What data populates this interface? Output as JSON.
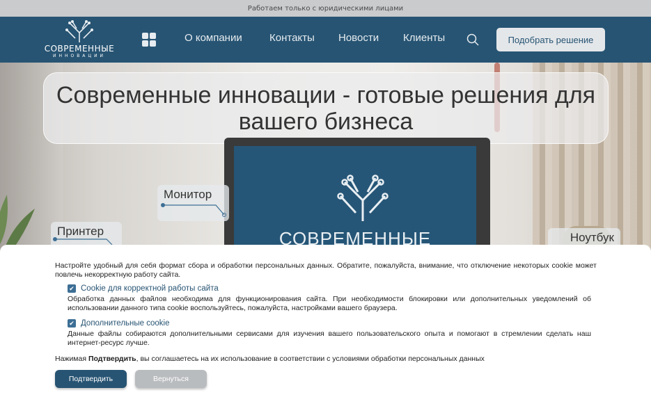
{
  "topbar": {
    "text": "Работаем только  с юридическими лицами"
  },
  "logo": {
    "line1": "СОВРЕМЕННЫЕ",
    "line2": "ИННОВАЦИИ"
  },
  "nav": {
    "links": [
      "О компании",
      "Контакты",
      "Новости",
      "Клиенты"
    ],
    "cta_label": "Подобрать решение"
  },
  "hero": {
    "headline": "Современные инновации - готовые решения для вашего бизнеса",
    "screen_text": "СОВРЕМЕННЫЕ",
    "tags": [
      "Монитор",
      "Принтер",
      "Ноутбук"
    ]
  },
  "cookie": {
    "intro": "Настройте удобный для себя формат сбора и обработки персональных данных. Обратите, пожалуйста, внимание, что отключение некоторых cookie может повлечь некорректную работу сайта.",
    "options": [
      {
        "title": "Cookie для корректной работы сайта",
        "description": "Обработка данных файлов необходима для функционирования сайта. При необходимости блокировки или дополнительных уведомлений об использовании данного типа cookie воспользуйтесь, пожалуйста, настройками вашего браузера.",
        "checked": true
      },
      {
        "title": "Дополнительные cookie",
        "description": "Данные файлы собираются дополнительными сервисами для изучения вашего пользовательского опыта и помогают в стремлении сделать наш интернет-ресурс лучше.",
        "checked": true
      }
    ],
    "agree_prefix": "Нажимая ",
    "agree_bold": "Подтвердить",
    "agree_suffix": ", вы соглашаетесь на их использование в соответствии с условиями обработки персональных данных",
    "confirm_label": "Подтвердить",
    "back_label": "Вернуться"
  },
  "colors": {
    "brand": "#275473",
    "light": "#e4e7ea"
  }
}
